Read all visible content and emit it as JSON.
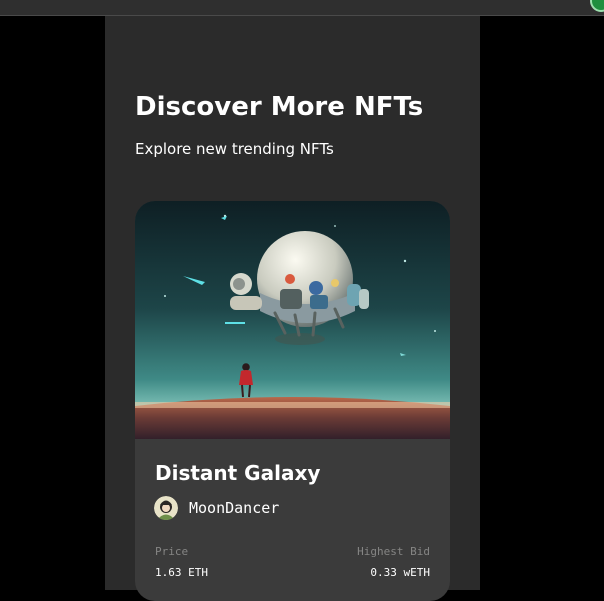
{
  "section": {
    "title": "Discover More NFTs",
    "subtitle": "Explore new trending NFTs"
  },
  "nft_card": {
    "title": "Distant Galaxy",
    "artist_name": "MoonDancer",
    "price_label": "Price",
    "price_value": "1.63 ETH",
    "bid_label": "Highest Bid",
    "bid_value": "0.33 wETH",
    "image_icon": "spaceship-artwork",
    "avatar_icon": "artist-avatar"
  },
  "colors": {
    "page_background": "#000000",
    "panel_background": "#2b2b2b",
    "card_background": "#3b3b3b",
    "muted_text": "#858584",
    "text": "#ffffff"
  }
}
